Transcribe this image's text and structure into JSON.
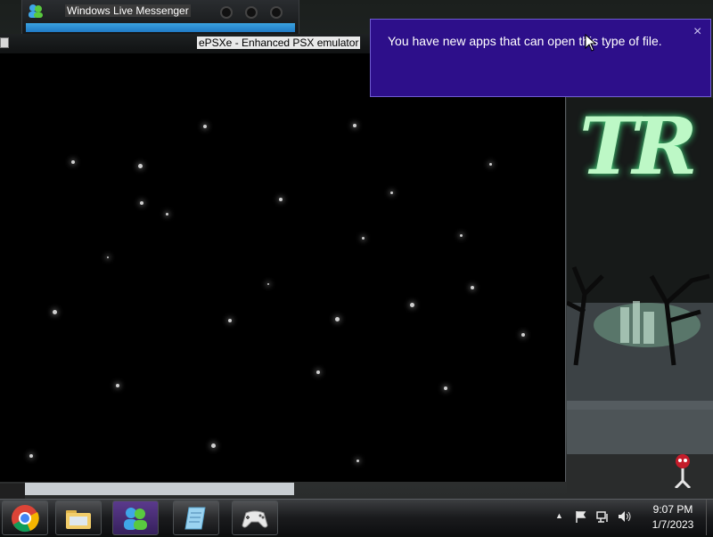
{
  "messenger": {
    "title": "Windows Live Messenger"
  },
  "epsxe": {
    "title": "ePSXe - Enhanced PSX emulator"
  },
  "notification": {
    "message": "You have new apps that can open this type of file.",
    "close_glyph": "×"
  },
  "wallpaper": {
    "letters": "TR"
  },
  "taskbar": {
    "apps": [
      {
        "name": "chrome",
        "icon": "chrome-icon"
      },
      {
        "name": "file-explorer",
        "icon": "folder-icon"
      },
      {
        "name": "windows-live-messenger",
        "icon": "messenger-icon",
        "active": true
      },
      {
        "name": "notepad",
        "icon": "notepad-icon"
      },
      {
        "name": "epsxe",
        "icon": "gamepad-icon"
      }
    ],
    "tray": {
      "overflow_glyph": "▲",
      "flag_icon": "flag-icon",
      "network_icon": "network-icon",
      "volume_icon": "volume-icon"
    },
    "clock": {
      "time": "9:07 PM",
      "date": "1/7/2023"
    }
  },
  "colors": {
    "toast_bg": "#2d0f8a",
    "messenger_accent": "#2079c4",
    "active_task": "#5b3a8c"
  }
}
